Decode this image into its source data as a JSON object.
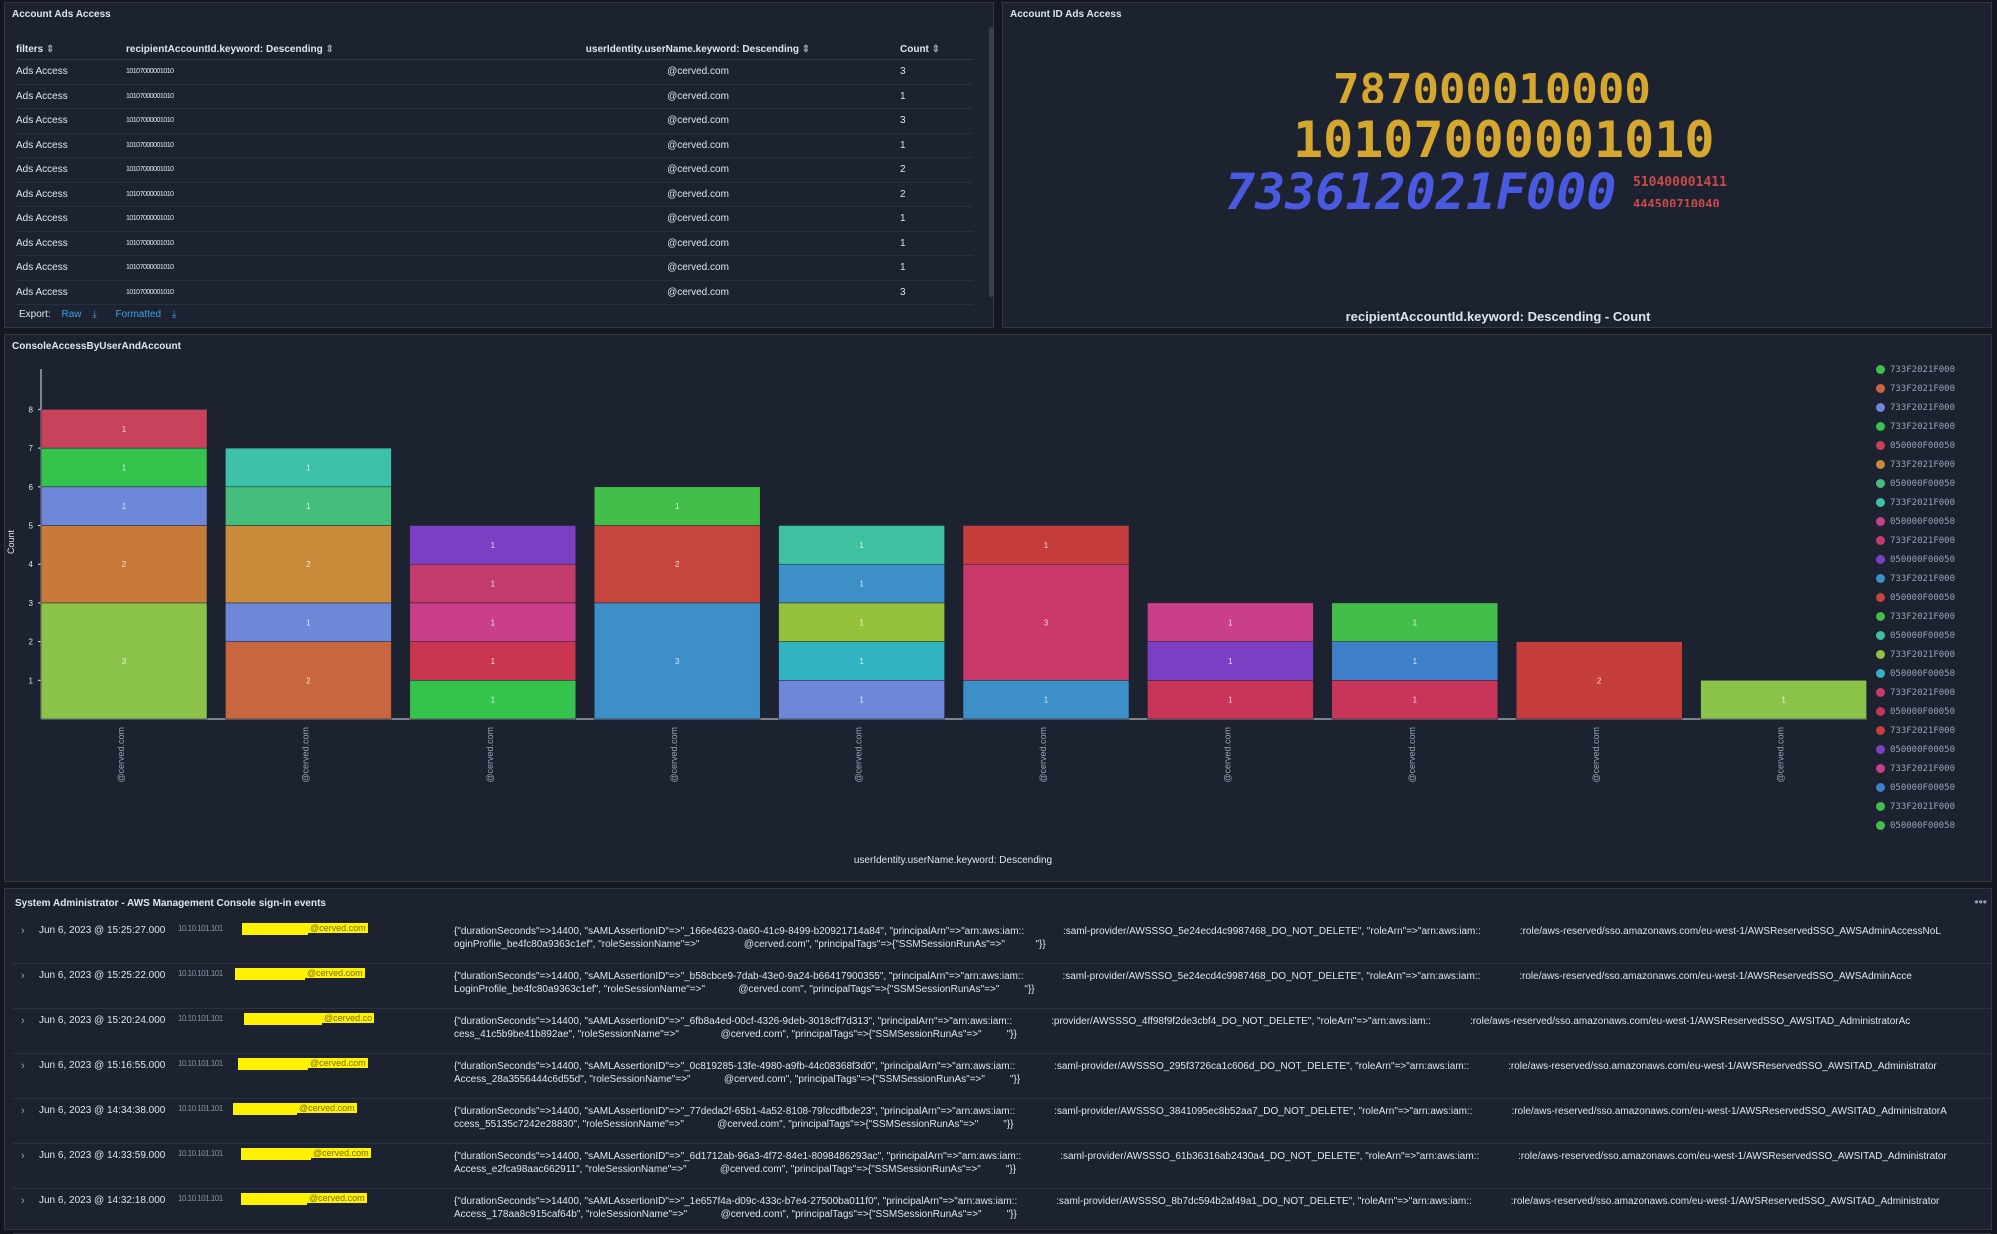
{
  "account_ads": {
    "title": "Account Ads Access",
    "headers": [
      "filters",
      "recipientAccountId.keyword: Descending",
      "userIdentity.userName.keyword: Descending",
      "Count"
    ],
    "rows": [
      {
        "filter": "Ads Access",
        "account": "10107000001010",
        "user": "@cerved.com",
        "count": "3"
      },
      {
        "filter": "Ads Access",
        "account": "10107000001010",
        "user": "@cerved.com",
        "count": "1"
      },
      {
        "filter": "Ads Access",
        "account": "10107000001010",
        "user": "@cerved.com",
        "count": "3"
      },
      {
        "filter": "Ads Access",
        "account": "10107000001010",
        "user": "@cerved.com",
        "count": "1"
      },
      {
        "filter": "Ads Access",
        "account": "10107000001010",
        "user": "@cerved.com",
        "count": "2"
      },
      {
        "filter": "Ads Access",
        "account": "10107000001010",
        "user": "@cerved.com",
        "count": "2"
      },
      {
        "filter": "Ads Access",
        "account": "10107000001010",
        "user": "@cerved.com",
        "count": "1"
      },
      {
        "filter": "Ads Access",
        "account": "10107000001010",
        "user": "@cerved.com",
        "count": "1"
      },
      {
        "filter": "Ads Access",
        "account": "10107000001010",
        "user": "@cerved.com",
        "count": "1"
      },
      {
        "filter": "Ads Access",
        "account": "10107000001010",
        "user": "@cerved.com",
        "count": "3"
      }
    ],
    "export_label": "Export:",
    "raw_label": "Raw",
    "formatted_label": "Formatted"
  },
  "account_id_ads": {
    "title": "Account ID Ads Access",
    "caption": "recipientAccountId.keyword: Descending - Count",
    "words": [
      {
        "text": "787000010000",
        "color": "#d6a72e"
      },
      {
        "text": "10107000001010",
        "color": "#d6a72e"
      },
      {
        "text": "733612021F000",
        "color": "#4a5ae0"
      },
      {
        "text": "510400001411",
        "color": "#c94a4a"
      },
      {
        "text": "444500710040",
        "color": "#c94a4a"
      }
    ]
  },
  "console_chart": {
    "title": "ConsoleAccessByUserAndAccount",
    "ylabel": "Count",
    "xlabel": "userIdentity.userName.keyword: Descending",
    "x_tick": "@cerved.com",
    "y_ticks": [
      "1",
      "2",
      "3",
      "4",
      "5",
      "6",
      "7",
      "8"
    ],
    "legend_entries": [
      "733F2021F000",
      "733F2021F000",
      "733F2021F000",
      "733F2021F000",
      "050000F00050",
      "733F2021F000",
      "050000F00050",
      "733F2021F000",
      "050000F00050",
      "733F2021F000",
      "050000F00050",
      "733F2021F000",
      "050000F00050",
      "733F2021F000",
      "050000F00050",
      "733F2021F000",
      "050000F00050",
      "733F2021F000",
      "050000F00050",
      "733F2021F000",
      "050000F00050",
      "733F2021F000",
      "050000F00050",
      "733F2021F000",
      "050000F00050"
    ]
  },
  "chart_data": {
    "type": "bar",
    "stacked": true,
    "categories": [
      "@cerved.com",
      "@cerved.com",
      "@cerved.com",
      "@cerved.com",
      "@cerved.com",
      "@cerved.com",
      "@cerved.com",
      "@cerved.com",
      "@cerved.com",
      "@cerved.com"
    ],
    "ylim": [
      0,
      9
    ],
    "ylabel": "Count",
    "xlabel": "userIdentity.userName.keyword: Descending",
    "stacks": [
      [
        {
          "v": 3,
          "c": "#8bc34a"
        },
        {
          "v": 2,
          "c": "#c77a3a"
        },
        {
          "v": 1,
          "c": "#6f87d8"
        },
        {
          "v": 1,
          "c": "#35c24d"
        },
        {
          "v": 1,
          "c": "#c9425c"
        }
      ],
      [
        {
          "v": 2,
          "c": "#c8663f"
        },
        {
          "v": 1,
          "c": "#6f87d8"
        },
        {
          "v": 2,
          "c": "#c98b3a"
        },
        {
          "v": 1,
          "c": "#44be7a"
        },
        {
          "v": 1,
          "c": "#3fc0a8"
        }
      ],
      [
        {
          "v": 1,
          "c": "#35c24d"
        },
        {
          "v": 1,
          "c": "#c9344f"
        },
        {
          "v": 1,
          "c": "#c93f8a"
        },
        {
          "v": 1,
          "c": "#c23a6e"
        },
        {
          "v": 1,
          "c": "#7b3fc4"
        }
      ],
      [
        {
          "v": 3,
          "c": "#3d8fc8"
        },
        {
          "v": 2,
          "c": "#c6453e"
        },
        {
          "v": 1,
          "c": "#44be4a"
        }
      ],
      [
        {
          "v": 1,
          "c": "#6f87d8"
        },
        {
          "v": 1,
          "c": "#31b3c2"
        },
        {
          "v": 1,
          "c": "#95c23a"
        },
        {
          "v": 1,
          "c": "#3d8fc8"
        },
        {
          "v": 1,
          "c": "#3fc0a0"
        }
      ],
      [
        {
          "v": 1,
          "c": "#3d8fc8"
        },
        {
          "v": 3,
          "c": "#c93a6a"
        },
        {
          "v": 1,
          "c": "#c63d3d"
        }
      ],
      [
        {
          "v": 1,
          "c": "#c9345a"
        },
        {
          "v": 1,
          "c": "#7b3fc4"
        },
        {
          "v": 1,
          "c": "#c93f8a"
        }
      ],
      [
        {
          "v": 1,
          "c": "#c9345a"
        },
        {
          "v": 1,
          "c": "#3d7fc8"
        },
        {
          "v": 1,
          "c": "#44be4a"
        }
      ],
      [
        {
          "v": 2,
          "c": "#c63d3d"
        }
      ],
      [
        {
          "v": 1,
          "c": "#8bc34a"
        }
      ]
    ]
  },
  "events": {
    "title": "System Administrator - AWS Management Console sign-in events",
    "rows": [
      {
        "time": "Jun 6, 2023 @ 15:25:27.000",
        "ip": "10.10.101.101",
        "user_hl": "@cerved.com",
        "msg1": "{\"durationSeconds\"=>14400, \"sAMLAssertionID\"=>\"_166e4623-0a60-41c9-8499-b20921714a84\", \"principalArn\"=>\"arn:aws:iam::              :saml-provider/AWSSSO_5e24ecd4c9987468_DO_NOT_DELETE\", \"roleArn\"=>\"arn:aws:iam::              :role/aws-reserved/sso.amazonaws.com/eu-west-1/AWSReservedSSO_AWSAdminAccessNoL",
        "msg2": "oginProfile_be4fc80a9363c1ef\", \"roleSessionName\"=>\"                @cerved.com\", \"principalTags\"=>{\"SSMSessionRunAs\"=>\"           \"}}"
      },
      {
        "time": "Jun 6, 2023 @ 15:25:22.000",
        "ip": "10.10.101.101",
        "user_hl": "@cerved.com",
        "msg1": "{\"durationSeconds\"=>14400, \"sAMLAssertionID\"=>\"_b58cbce9-7dab-43e0-9a24-b66417900355\", \"principalArn\"=>\"arn:aws:iam::              :saml-provider/AWSSSO_5e24ecd4c9987468_DO_NOT_DELETE\", \"roleArn\"=>\"arn:aws:iam::              :role/aws-reserved/sso.amazonaws.com/eu-west-1/AWSReservedSSO_AWSAdminAcce",
        "msg2": "LoginProfile_be4fc80a9363c1ef\", \"roleSessionName\"=>\"            @cerved.com\", \"principalTags\"=>{\"SSMSessionRunAs\"=>\"         \"}}"
      },
      {
        "time": "Jun 6, 2023 @ 15:20:24.000",
        "ip": "10.10.101.101",
        "user_hl": "@cerved.co",
        "msg1": "{\"durationSeconds\"=>14400, \"sAMLAssertionID\"=>\"_6fb8a4ed-00cf-4326-9deb-3018cff7d313\", \"principalArn\"=>\"arn:aws:iam::              :provider/AWSSSO_4ff98f9f2de3cbf4_DO_NOT_DELETE\", \"roleArn\"=>\"arn:aws:iam::              :role/aws-reserved/sso.amazonaws.com/eu-west-1/AWSReservedSSO_AWSITAD_AdministratorAc",
        "msg2": "cess_41c5b9be41b892ae\", \"roleSessionName\"=>\"               @cerved.com\", \"principalTags\"=>{\"SSMSessionRunAs\"=>\"         \"}}"
      },
      {
        "time": "Jun 6, 2023 @ 15:16:55.000",
        "ip": "10.10.101.101",
        "user_hl": "@cerved.com",
        "msg1": "{\"durationSeconds\"=>14400, \"sAMLAssertionID\"=>\"_0c819285-13fe-4980-a9fb-44c08368f3d0\", \"principalArn\"=>\"arn:aws:iam::              :saml-provider/AWSSSO_295f3726ca1c606d_DO_NOT_DELETE\", \"roleArn\"=>\"arn:aws:iam::              :role/aws-reserved/sso.amazonaws.com/eu-west-1/AWSReservedSSO_AWSITAD_Administrator",
        "msg2": "Access_28a3556444c6d55d\", \"roleSessionName\"=>\"            @cerved.com\", \"principalTags\"=>{\"SSMSessionRunAs\"=>\"         \"}}"
      },
      {
        "time": "Jun 6, 2023 @ 14:34:38.000",
        "ip": "10.10.101.101",
        "user_hl": "@cerved.com",
        "msg1": "{\"durationSeconds\"=>14400, \"sAMLAssertionID\"=>\"_77deda2f-65b1-4a52-8108-79fccdfbde23\", \"principalArn\"=>\"arn:aws:iam::              :saml-provider/AWSSSO_3841095ec8b52aa7_DO_NOT_DELETE\", \"roleArn\"=>\"arn:aws:iam::              :role/aws-reserved/sso.amazonaws.com/eu-west-1/AWSReservedSSO_AWSITAD_AdministratorA",
        "msg2": "ccess_55135c7242e28830\", \"roleSessionName\"=>\"            @cerved.com\", \"principalTags\"=>{\"SSMSessionRunAs\"=>\"         \"}}"
      },
      {
        "time": "Jun 6, 2023 @ 14:33:59.000",
        "ip": "10.10.101.101",
        "user_hl": "@cerved.com",
        "msg1": "{\"durationSeconds\"=>14400, \"sAMLAssertionID\"=>\"_6d1712ab-96a3-4f72-84e1-8098486293ac\", \"principalArn\"=>\"arn:aws:iam::              :saml-provider/AWSSSO_61b36316ab2430a4_DO_NOT_DELETE\", \"roleArn\"=>\"arn:aws:iam::              :role/aws-reserved/sso.amazonaws.com/eu-west-1/AWSReservedSSO_AWSITAD_Administrator",
        "msg2": "Access_e2fca98aac662911\", \"roleSessionName\"=>\"            @cerved.com\", \"principalTags\"=>{\"SSMSessionRunAs\"=>\"         \"}}"
      },
      {
        "time": "Jun 6, 2023 @ 14:32:18.000",
        "ip": "10.10.101.101",
        "user_hl": "@cerved.com",
        "msg1": "{\"durationSeconds\"=>14400, \"sAMLAssertionID\"=>\"_1e657f4a-d09c-433c-b7e4-27500ba011f0\", \"principalArn\"=>\"arn:aws:iam::              :saml-provider/AWSSSO_8b7dc594b2af49a1_DO_NOT_DELETE\", \"roleArn\"=>\"arn:aws:iam::              :role/aws-reserved/sso.amazonaws.com/eu-west-1/AWSReservedSSO_AWSITAD_Administrator",
        "msg2": "Access_178aa8c915caf64b\", \"roleSessionName\"=>\"            @cerved.com\", \"principalTags\"=>{\"SSMSessionRunAs\"=>\"         \"}}"
      }
    ]
  }
}
